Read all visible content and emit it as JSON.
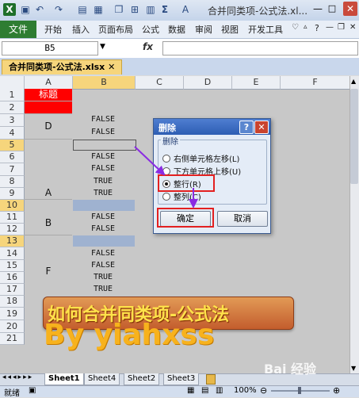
{
  "window": {
    "title": "合并同类项-公式法.xl..."
  },
  "ribbon": {
    "tabs": [
      "文件",
      "开始",
      "插入",
      "页面布局",
      "公式",
      "数据",
      "审阅",
      "视图",
      "开发工具"
    ]
  },
  "formula_bar": {
    "name_box": "B5",
    "fx": "fx",
    "value": ""
  },
  "workbook": {
    "tab": "合并同类项-公式法.xlsx"
  },
  "columns": [
    "A",
    "B",
    "C",
    "D",
    "E",
    "F"
  ],
  "rows": [
    "1",
    "2",
    "3",
    "4",
    "5",
    "6",
    "7",
    "8",
    "9",
    "10",
    "11",
    "12",
    "13",
    "14",
    "15",
    "16",
    "17",
    "18",
    "19",
    "20",
    "21"
  ],
  "cells": {
    "A1": "标题",
    "groups": [
      "D",
      "A",
      "B",
      "F"
    ],
    "B": [
      "FALSE",
      "FALSE",
      "FALSE",
      "FALSE",
      "TRUE",
      "TRUE",
      "FALSE",
      "FALSE",
      "FALSE",
      "FALSE",
      "TRUE",
      "TRUE"
    ]
  },
  "dialog": {
    "title": "删除",
    "help": "?",
    "close": "✕",
    "group": "删除",
    "options": [
      "右侧单元格左移(L)",
      "下方单元格上移(U)",
      "整行(R)",
      "整列(C)"
    ],
    "selected": 2,
    "ok": "确定",
    "cancel": "取消"
  },
  "banner": {
    "text": "如何合并同类项-公式法",
    "byline": "By  yiahxss"
  },
  "sheets": [
    "Sheet1",
    "Sheet4",
    "Sheet2",
    "Sheet3"
  ],
  "status": {
    "ready": "就绪",
    "zoom": "100%"
  },
  "watermark": "Bai 经验",
  "colors": {
    "header_red": "#ff0000",
    "selected_row": "#9fb2d0",
    "file_green": "#2e7d32",
    "dialog_title": "#2d5db3",
    "highlight_box": "#e32020",
    "arrow": "#8a2be2"
  }
}
